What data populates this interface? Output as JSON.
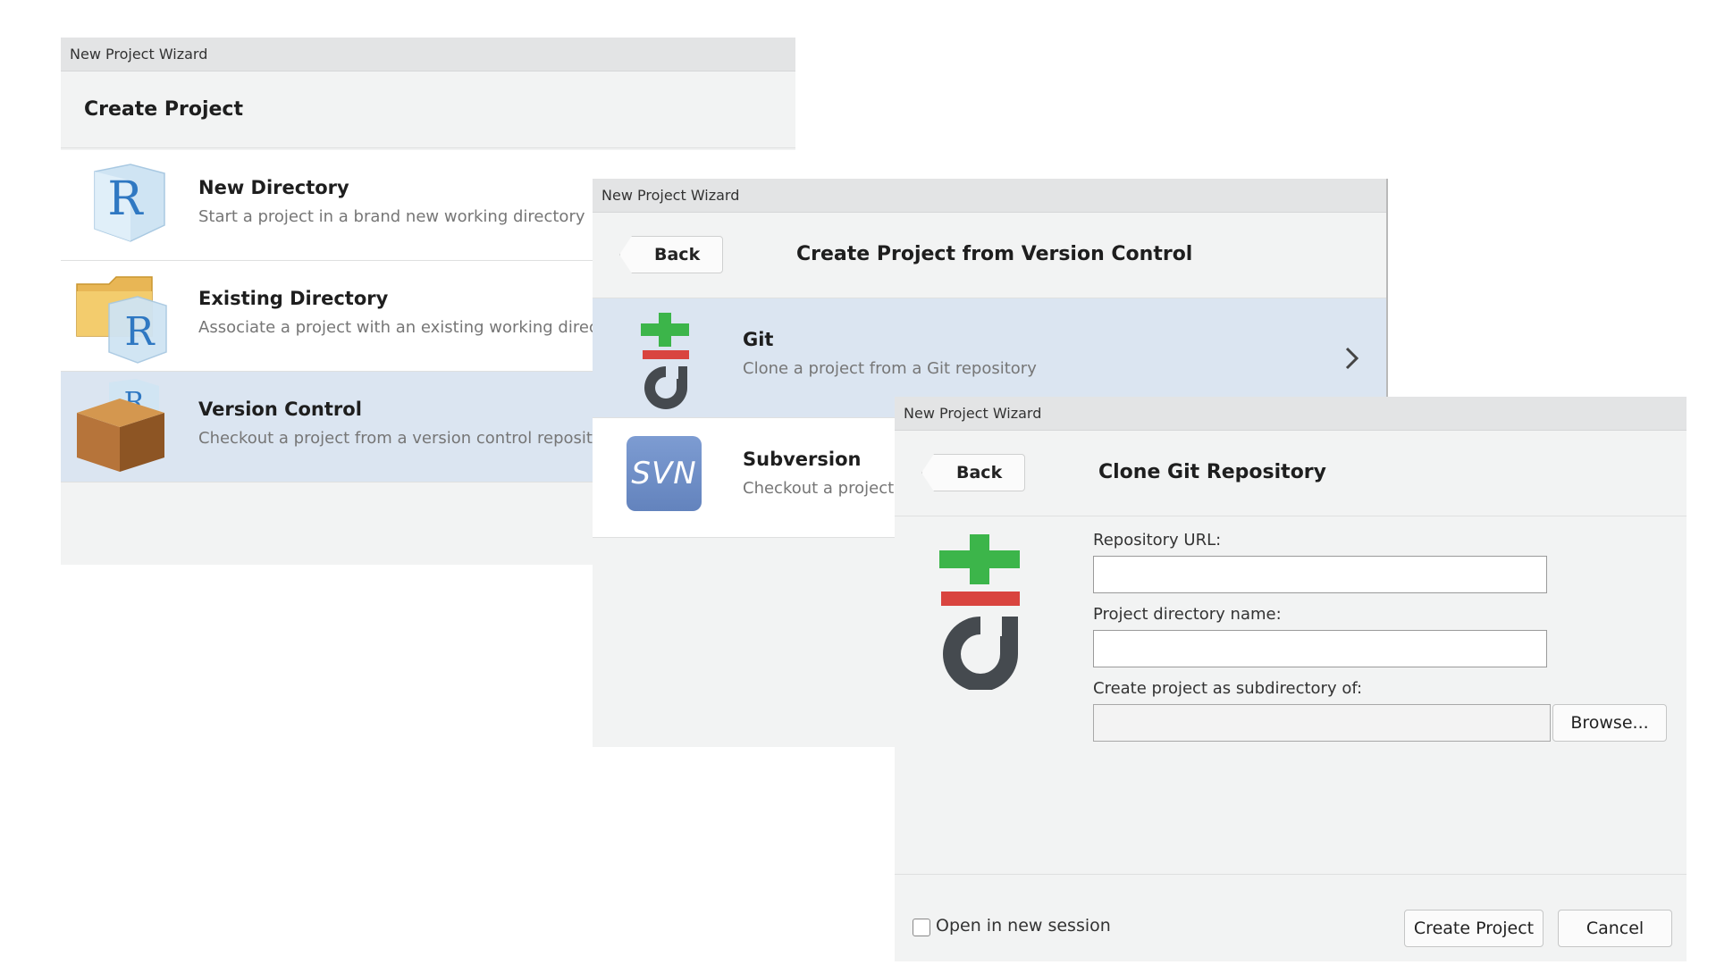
{
  "dialog1": {
    "window_title": "New Project Wizard",
    "heading": "Create Project",
    "options": [
      {
        "title": "New Directory",
        "desc": "Start a project in a brand new working directory",
        "icon": "r-cube-icon"
      },
      {
        "title": "Existing Directory",
        "desc": "Associate a project with an existing working directory",
        "icon": "folder-r-icon"
      },
      {
        "title": "Version Control",
        "desc": "Checkout a project from a version control repository",
        "icon": "box-icon"
      }
    ]
  },
  "dialog2": {
    "window_title": "New Project Wizard",
    "back_label": "Back",
    "heading": "Create Project from Version Control",
    "options": [
      {
        "title": "Git",
        "desc": "Clone a project from a Git repository",
        "icon": "git-icon"
      },
      {
        "title": "Subversion",
        "desc": "Checkout a project",
        "icon": "svn-icon",
        "icon_text": "SVN"
      }
    ]
  },
  "dialog3": {
    "window_title": "New Project Wizard",
    "back_label": "Back",
    "heading": "Clone Git Repository",
    "repo_url_label": "Repository URL:",
    "repo_url_value": "",
    "dir_name_label": "Project directory name:",
    "dir_name_value": "",
    "subdir_label": "Create project as subdirectory of:",
    "subdir_value": "",
    "browse_label": "Browse...",
    "open_new_session_label": "Open in new session",
    "open_new_session_checked": false,
    "create_label": "Create Project",
    "cancel_label": "Cancel"
  },
  "colors": {
    "selected_row": "#dbe5f1",
    "git_green": "#3cb54a",
    "git_red": "#d9443f",
    "git_gray": "#454a4f",
    "svn_blue": "#6f8fc6"
  }
}
